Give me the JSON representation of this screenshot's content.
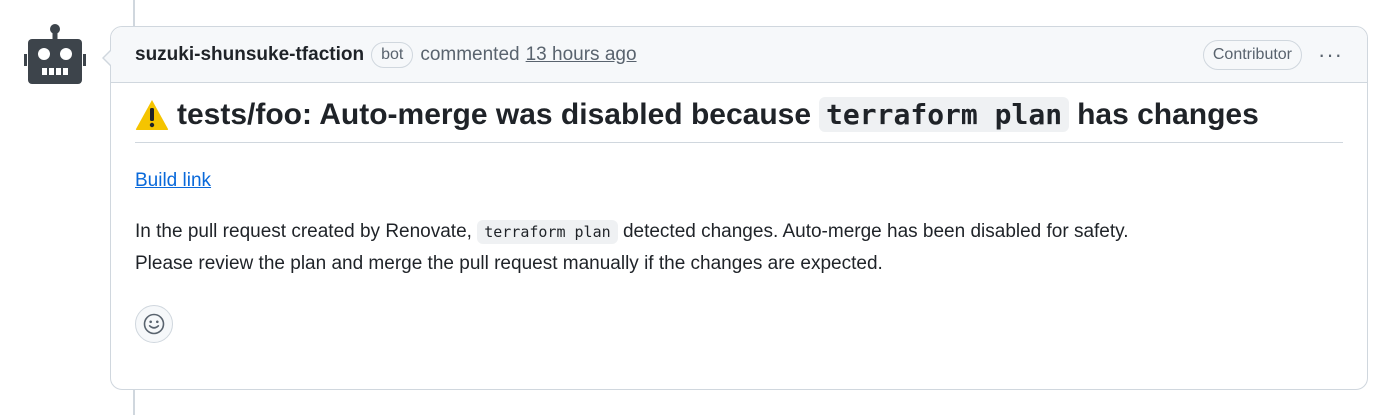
{
  "comment": {
    "author": "suzuki-shunsuke-tfaction",
    "bot_badge": "bot",
    "action_text": "commented",
    "timestamp": "13 hours ago",
    "role_badge": "Contributor",
    "more_label": "···",
    "title_prefix": "tests/foo: Auto-merge was disabled because",
    "title_code": "terraform plan",
    "title_suffix": "has changes",
    "build_link": "Build link",
    "body_prefix": "In the pull request created by Renovate,",
    "body_code": "terraform plan",
    "body_suffix": "detected changes. Auto-merge has been disabled for safety.",
    "body_line2": "Please review the plan and merge the pull request manually if the changes are expected."
  },
  "icons": {
    "avatar": "robot-icon",
    "warning": "warning-icon",
    "reaction": "smiley-icon",
    "more": "kebab-icon"
  },
  "colors": {
    "link": "#0969da",
    "border": "#d0d7de",
    "header_bg": "#f6f8fa",
    "muted_text": "#59636e",
    "warning_yellow": "#f5c400"
  }
}
